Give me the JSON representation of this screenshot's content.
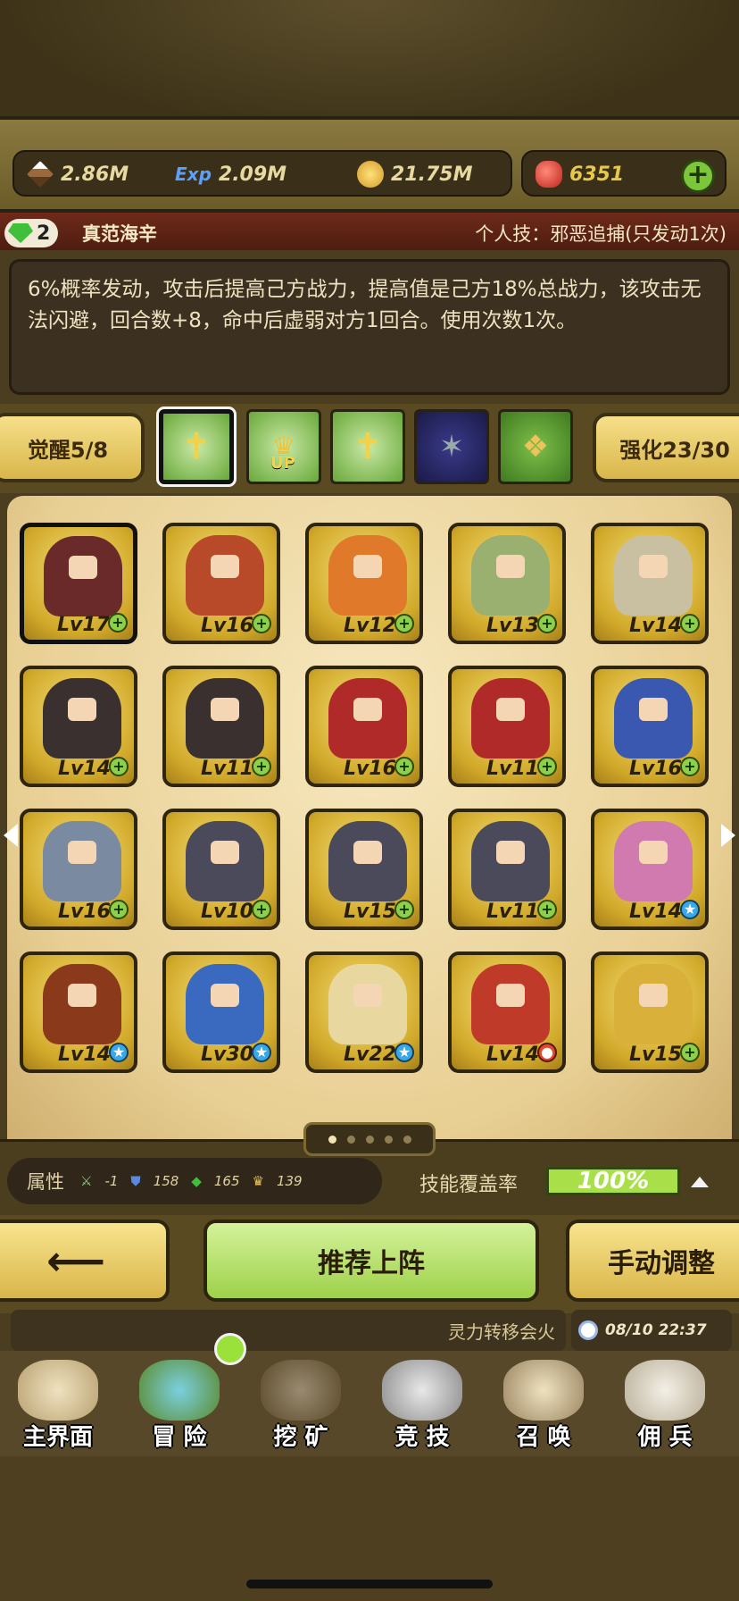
{
  "currency": {
    "attack": "2.86M",
    "exp_icon_label": "Exp",
    "exp": "2.09M",
    "gold": "21.75M",
    "ruby": "6351"
  },
  "skill": {
    "gem_count": "2",
    "hero_name": "真范海辛",
    "skill_title": "个人技：邪恶追捕(只发动1次)",
    "description": "6%概率发动，攻击后提高己方战力，提高值是己方18%总战力，该攻击无法闪避，回合数+8，命中后虚弱对方1回合。使用次数1次。"
  },
  "awaken": {
    "label": "觉醒5/8",
    "enhance_label": "强化23/30",
    "up_text": "UP"
  },
  "heroes": [
    {
      "level": "Lv17",
      "badge": "plus"
    },
    {
      "level": "Lv16",
      "badge": "plus"
    },
    {
      "level": "Lv12",
      "badge": "plus"
    },
    {
      "level": "Lv13",
      "badge": "plus"
    },
    {
      "level": "Lv14",
      "badge": "plus"
    },
    {
      "level": "Lv14",
      "badge": "plus"
    },
    {
      "level": "Lv11",
      "badge": "plus"
    },
    {
      "level": "Lv16",
      "badge": "plus"
    },
    {
      "level": "Lv11",
      "badge": "plus"
    },
    {
      "level": "Lv16",
      "badge": "plus"
    },
    {
      "level": "Lv16",
      "badge": "plus"
    },
    {
      "level": "Lv10",
      "badge": "plus"
    },
    {
      "level": "Lv15",
      "badge": "plus"
    },
    {
      "level": "Lv11",
      "badge": "plus"
    },
    {
      "level": "Lv14",
      "badge": "star"
    },
    {
      "level": "Lv14",
      "badge": "star"
    },
    {
      "level": "Lv30",
      "badge": "star"
    },
    {
      "level": "Lv22",
      "badge": "star"
    },
    {
      "level": "Lv14",
      "badge": "red"
    },
    {
      "level": "Lv15",
      "badge": "plus"
    }
  ],
  "attributes": {
    "label": "属性",
    "values": [
      "-1",
      "158",
      "165",
      "139"
    ]
  },
  "coverage": {
    "label": "技能覆盖率",
    "value": "100%"
  },
  "actions": {
    "recommend": "推荐上阵",
    "manual": "手动调整"
  },
  "ticker": {
    "text": "灵力转移会火",
    "time": "08/10 22:37"
  },
  "nav": [
    "主界面",
    "冒 险",
    "挖 矿",
    "竞 技",
    "召 唤",
    "佣 兵"
  ],
  "colors": {
    "gold_card": "#d1a92a",
    "panel_bg": "#f7e8bf",
    "accent_green": "#a9e04a"
  }
}
